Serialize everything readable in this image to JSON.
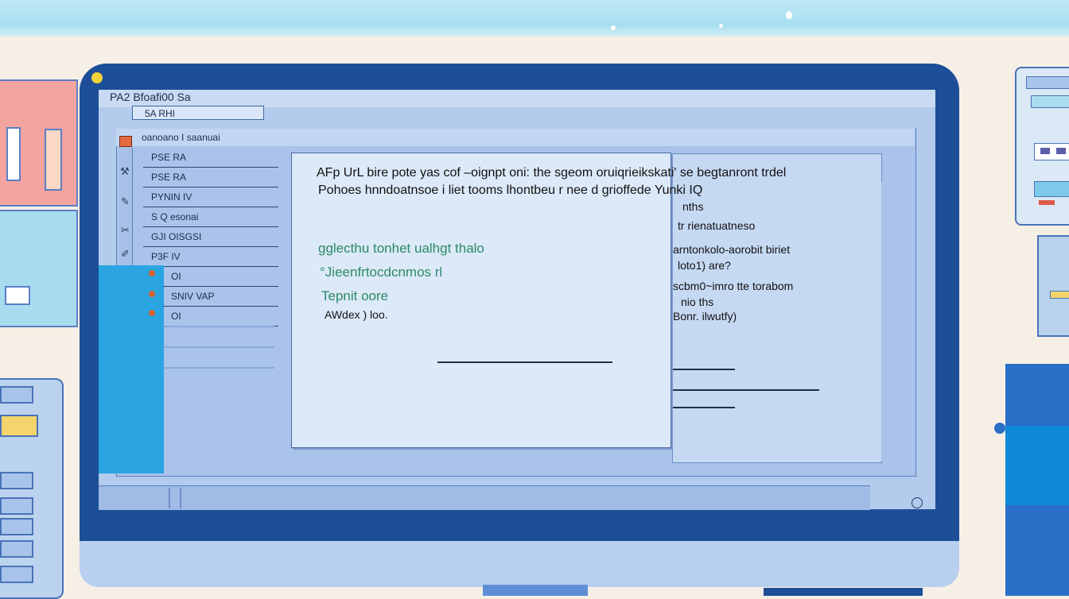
{
  "window": {
    "title": "PA2 Bfoafi00 Sa",
    "address": "5A RHI",
    "header": "oanoano  I saanuai"
  },
  "sidebar": {
    "items": [
      "PSE RA",
      "PSE RA",
      "PYNIN IV",
      "S Q esonai",
      "GJI OISGSI",
      "P3F IV"
    ],
    "items2": [
      "OI",
      "SNIV VAP",
      "OI"
    ]
  },
  "document": {
    "heading_line1": "AFp UrL bire pote yas cof –oignpt oni: the sgeom oruiqrieikskati' se begtanront trdel",
    "heading_line2": "Pohoes hnndoatnsoe i liet tooms lhontbeu r nee d grioffede Yunki IQ",
    "green_lines": [
      "gglecthu tonhet ualhgt thalo",
      "°Jieenfrtocdcnmos rl",
      "Tepnit oore"
    ],
    "note": "AWdex ) loo."
  },
  "right_panel": {
    "lines": [
      "nths",
      "tr rienatuatneso",
      "arntonkolo-aorobit biriet",
      "loto1) are?",
      "scbm0~imro tte torabom",
      "nio ths",
      "Bonr. ilwutfy)"
    ]
  },
  "colors": {
    "bezel": "#1c4f97",
    "screen": "#b3cbec",
    "accent": "#2aa5e2",
    "green_text": "#2c8a68",
    "bullet": "#d06432",
    "led": "#f2d33a"
  }
}
